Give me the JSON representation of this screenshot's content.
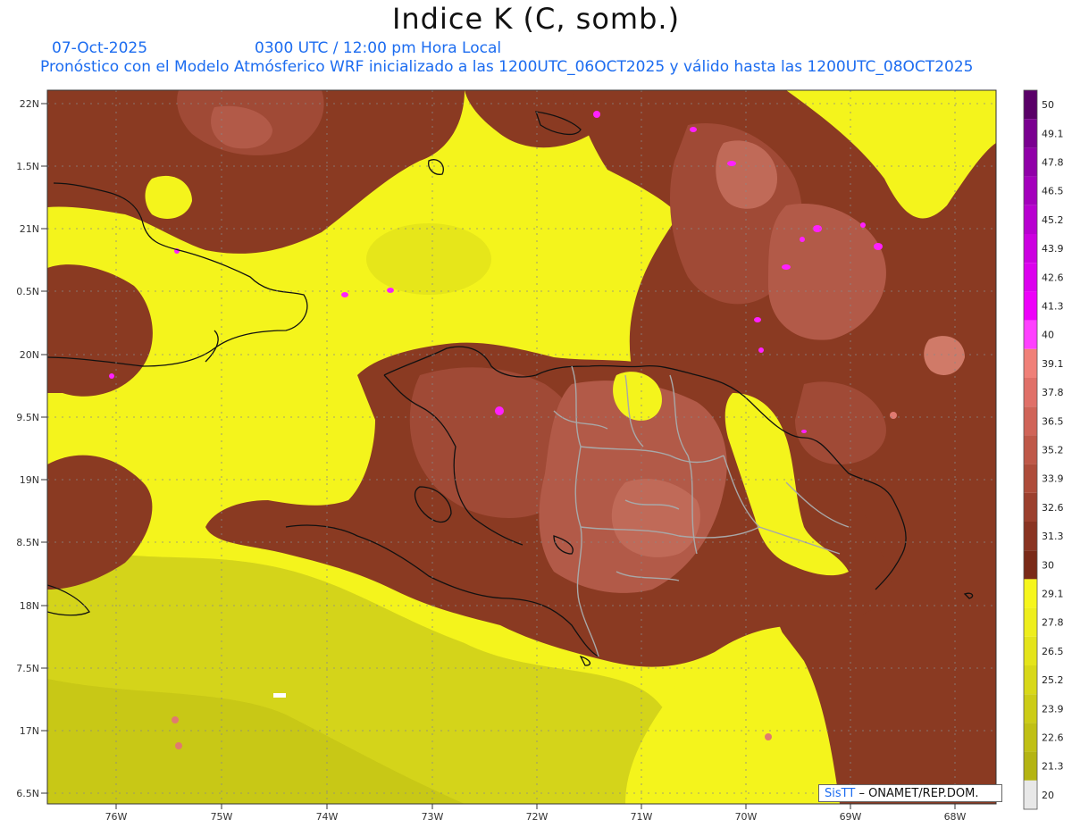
{
  "header": {
    "title": "Indice K (C, somb.)",
    "date": "07-Oct-2025",
    "time": "0300 UTC / 12:00 pm Hora Local",
    "description": "Pronóstico con el Modelo Atmósferico WRF inicializado a las 1200UTC_06OCT2025 y válido hasta las  1200UTC_08OCT2025"
  },
  "axes": {
    "lat_labels": [
      "22N",
      "1.5N",
      "21N",
      "0.5N",
      "20N",
      "9.5N",
      "19N",
      "8.5N",
      "18N",
      "7.5N",
      "17N",
      "6.5N"
    ],
    "lon_labels": [
      "76W",
      "75W",
      "74W",
      "73W",
      "72W",
      "71W",
      "70W",
      "69W",
      "68W"
    ]
  },
  "colorbar": {
    "labels": [
      "50",
      "49.1",
      "47.8",
      "46.5",
      "45.2",
      "43.9",
      "42.6",
      "41.3",
      "40",
      "39.1",
      "37.8",
      "36.5",
      "35.2",
      "33.9",
      "32.6",
      "31.3",
      "30",
      "29.1",
      "27.8",
      "26.5",
      "25.2",
      "23.9",
      "22.6",
      "21.3",
      "20"
    ],
    "colors": [
      "#5a0068",
      "#7a0090",
      "#9000a8",
      "#a400bc",
      "#b800d0",
      "#cc00e0",
      "#dc00ee",
      "#ee00fa",
      "#ff40ff",
      "#f08078",
      "#e07068",
      "#d06458",
      "#bf5848",
      "#ae4c3a",
      "#9c402e",
      "#8a3422",
      "#7a2a18",
      "#f6f61c",
      "#eeee1c",
      "#e4e41a",
      "#d8d818",
      "#cccc16",
      "#c0c014",
      "#b4b412",
      "#e8e8e8"
    ]
  },
  "credit": {
    "brand": "SisTT",
    "text": "– ONAMET/REP.DOM."
  },
  "colors": {
    "yellow": "#f4f41c",
    "olive": "#cdcd18",
    "brown": "#8a3a22",
    "rose": "#b25a48",
    "pink": "#d07a68",
    "magenta": "#ff20ff",
    "grid": "#888888"
  }
}
